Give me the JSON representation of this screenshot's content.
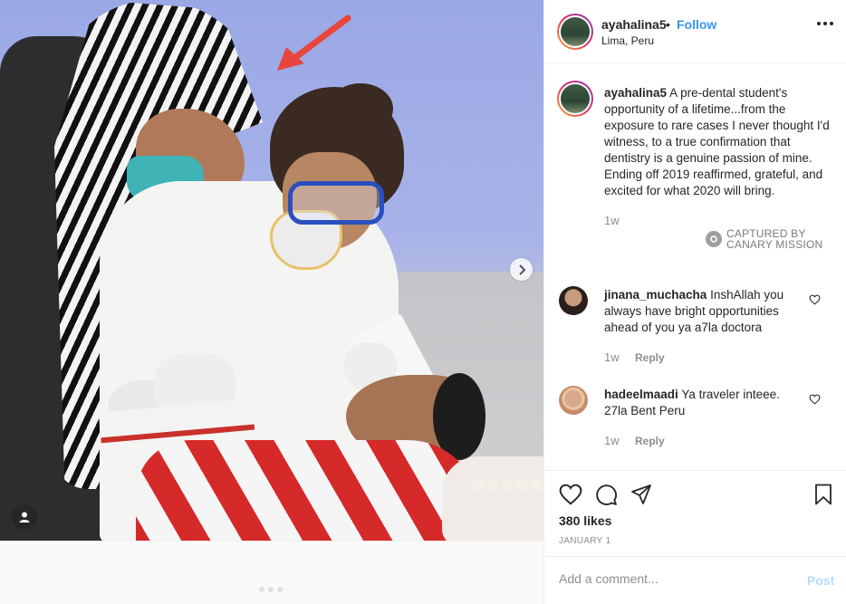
{
  "post": {
    "username": "ayahalina5",
    "follow_label": "Follow",
    "separator": "•",
    "location": "Lima, Peru",
    "caption": "A pre-dental student's opportunity of a lifetime...from the exposure to rare cases I never thought I'd witness, to a true confirmation that dentistry is a genuine passion of mine. Ending off 2019 reaffirmed, grateful, and excited for what 2020 will bring.",
    "caption_time": "1w",
    "likes": "380 likes",
    "date": "JANUARY 1"
  },
  "watermark": {
    "line1": "CAPTURED BY",
    "line2": "CANARY MISSION"
  },
  "comments": [
    {
      "username": "jinana_muchacha",
      "text": "InshAllah you always have bright opportunities ahead of you ya a7la doctora",
      "time": "1w",
      "reply_label": "Reply"
    },
    {
      "username": "hadeelmaadi",
      "text": "Ya traveler inteee. 27la Bent Peru",
      "time": "1w",
      "reply_label": "Reply"
    }
  ],
  "add_comment": {
    "placeholder": "Add a comment...",
    "post_label": "Post"
  },
  "icons": {
    "more": "more-options-icon",
    "heart": "heart-icon",
    "comment": "comment-icon",
    "share": "share-icon",
    "save": "bookmark-icon",
    "next": "chevron-right-icon",
    "tag": "user-tag-icon",
    "annotation": "red-arrow-icon"
  },
  "colors": {
    "link": "#3897f0",
    "arrow": "#e8453c",
    "post_disabled": "#b3dbff"
  }
}
